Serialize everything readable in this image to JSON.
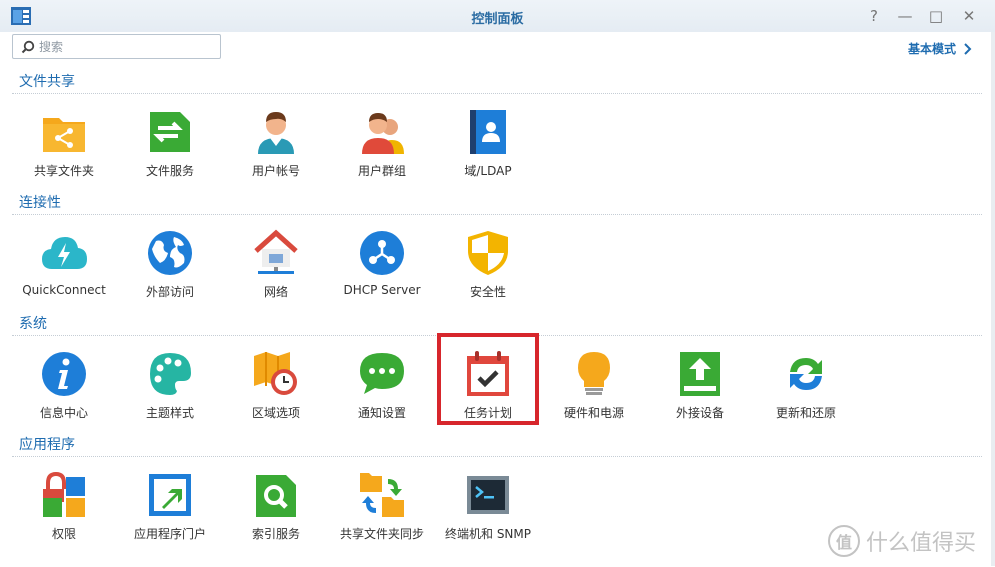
{
  "window": {
    "title": "控制面板"
  },
  "controls": {
    "help": "?",
    "minimize": "—",
    "maximize": "□",
    "close": "✕"
  },
  "search": {
    "placeholder": "搜索"
  },
  "header": {
    "mode_label": "基本模式"
  },
  "sections": [
    {
      "title": "文件共享",
      "items": [
        "共享文件夹",
        "文件服务",
        "用户帐号",
        "用户群组",
        "域/LDAP"
      ]
    },
    {
      "title": "连接性",
      "items": [
        "QuickConnect",
        "外部访问",
        "网络",
        "DHCP Server",
        "安全性"
      ]
    },
    {
      "title": "系统",
      "items": [
        "信息中心",
        "主题样式",
        "区域选项",
        "通知设置",
        "任务计划",
        "硬件和电源",
        "外接设备",
        "更新和还原"
      ]
    },
    {
      "title": "应用程序",
      "items": [
        "权限",
        "应用程序门户",
        "索引服务",
        "共享文件夹同步",
        "终端机和 SNMP"
      ]
    }
  ],
  "watermark": {
    "badge": "值",
    "text": "什么值得买"
  },
  "colors": {
    "accent": "#1f6cb0",
    "highlight": "#d7262c"
  }
}
